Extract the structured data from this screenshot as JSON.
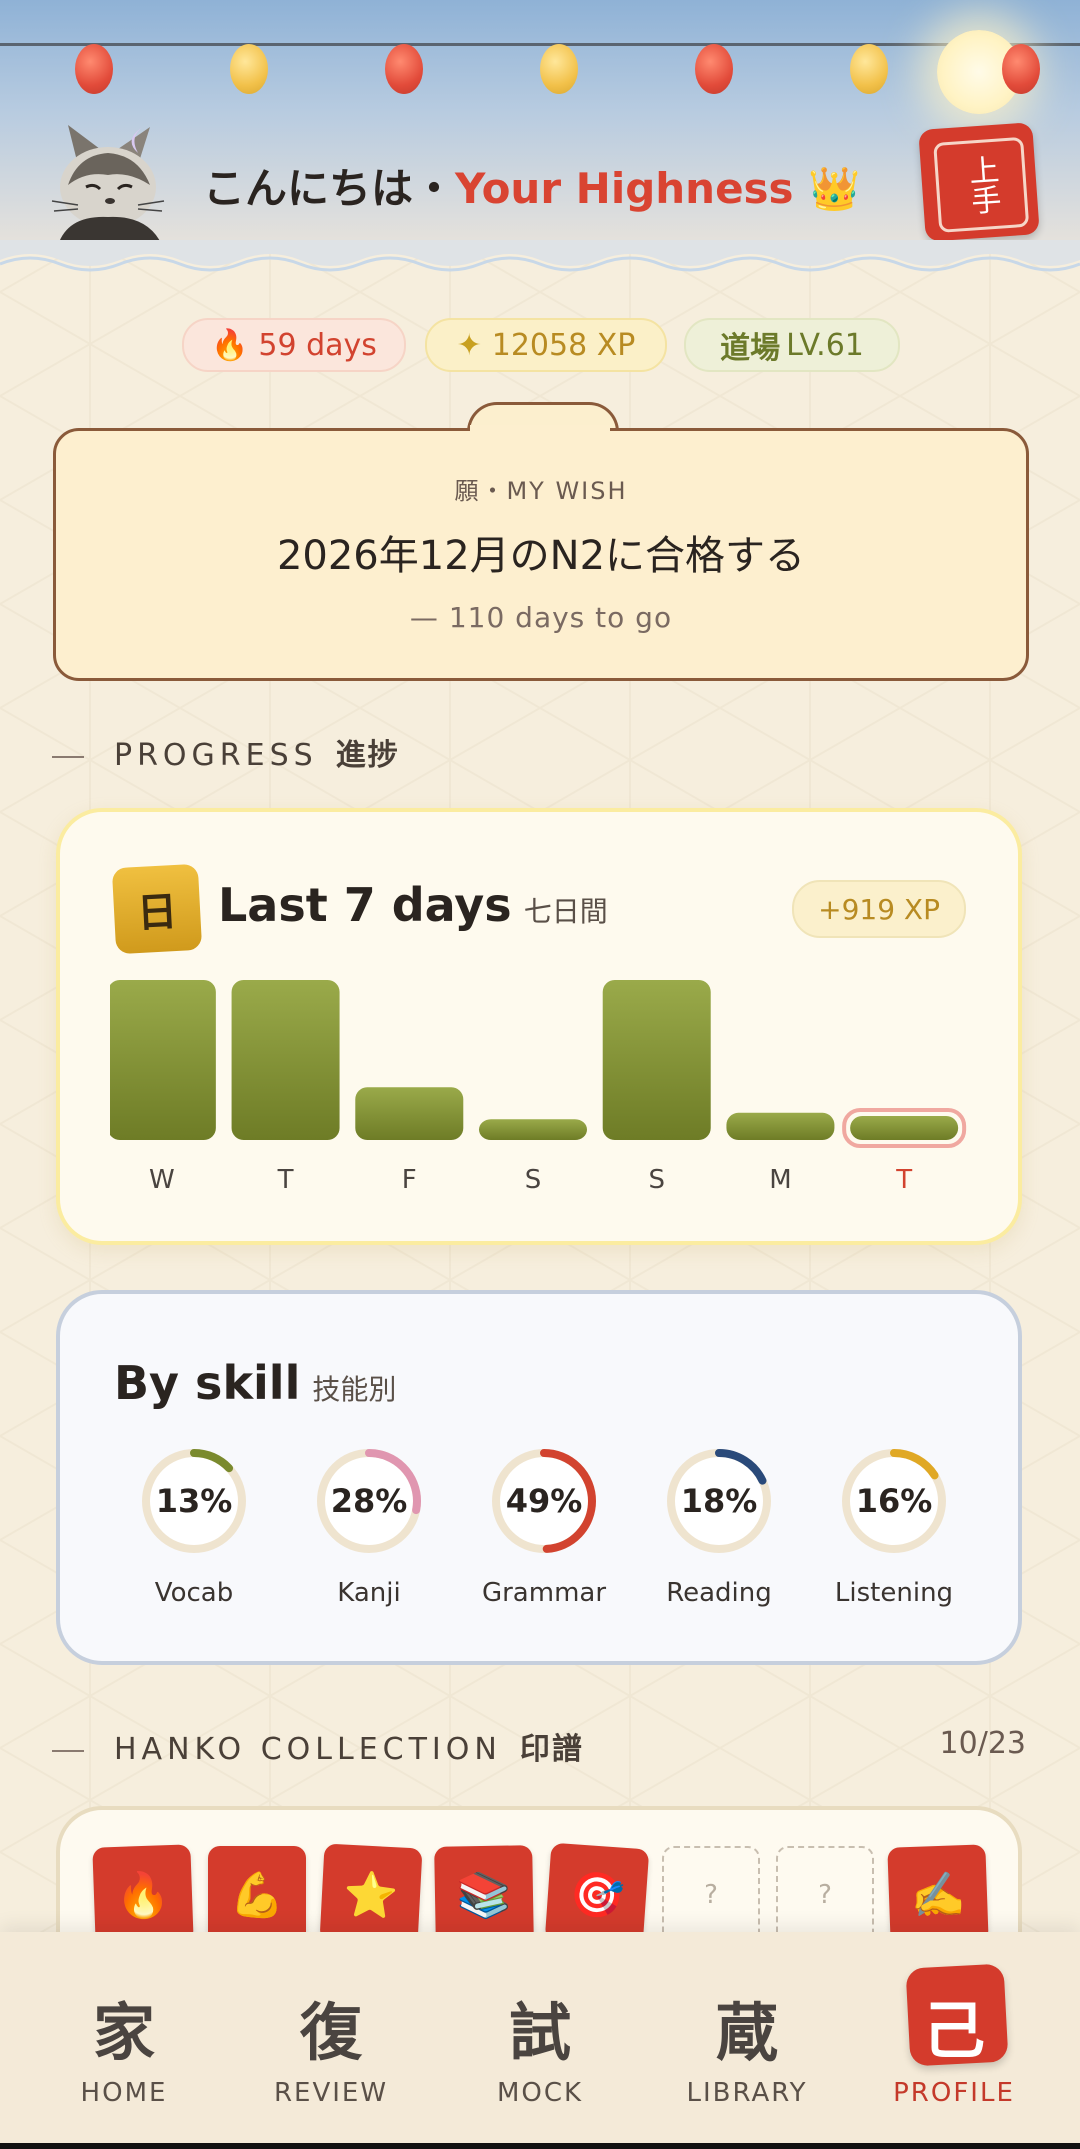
{
  "header": {
    "greeting": "こんにちは・",
    "name": "Your Highness",
    "crown": "👑",
    "hanko_text": "上手"
  },
  "stats": {
    "streak_icon": "🔥",
    "streak": "59 days",
    "xp_icon": "✦",
    "xp": "12058 XP",
    "dojo_label": "道場",
    "level": "LV.61"
  },
  "wish": {
    "label": "願・MY WISH",
    "goal": "2026年12月のN2に合格する",
    "countdown": "— 110 days to go"
  },
  "progress_section": {
    "title": "PROGRESS",
    "jp": "進捗"
  },
  "week_card": {
    "icon_char": "日",
    "title": "Last 7 days",
    "subtitle": "七日間",
    "xp_badge": "+919 XP"
  },
  "chart_data": {
    "type": "bar",
    "categories": [
      "W",
      "T",
      "F",
      "S",
      "S",
      "M",
      "T"
    ],
    "values": [
      100,
      100,
      33,
      13,
      100,
      17,
      15
    ],
    "highlight_index": 6,
    "colors": {
      "bar": "#7a8a2e",
      "highlight_text": "#d2432f",
      "highlight_outline": "#f0a8a0"
    }
  },
  "skill_card": {
    "title": "By skill",
    "subtitle": "技能別",
    "skills": [
      {
        "label": "Vocab",
        "pct": "13%",
        "value": 13,
        "color": "#7a8a2e"
      },
      {
        "label": "Kanji",
        "pct": "28%",
        "value": 28,
        "color": "#e096b0"
      },
      {
        "label": "Grammar",
        "pct": "49%",
        "value": 49,
        "color": "#d2432f"
      },
      {
        "label": "Reading",
        "pct": "18%",
        "value": 18,
        "color": "#2a4a7a"
      },
      {
        "label": "Listening",
        "pct": "16%",
        "value": 16,
        "color": "#e0a824"
      }
    ]
  },
  "hanko_section": {
    "title": "HANKO COLLECTION",
    "jp": "印譜",
    "count": "10/23"
  },
  "stamps": [
    "🔥",
    "💪",
    "⭐",
    "📚",
    "🎯",
    "?",
    "?",
    "✍️"
  ],
  "nav": [
    {
      "kanji": "家",
      "label": "HOME"
    },
    {
      "kanji": "復",
      "label": "REVIEW"
    },
    {
      "kanji": "試",
      "label": "MOCK"
    },
    {
      "kanji": "蔵",
      "label": "LIBRARY"
    },
    {
      "kanji": "己",
      "label": "PROFILE"
    }
  ]
}
